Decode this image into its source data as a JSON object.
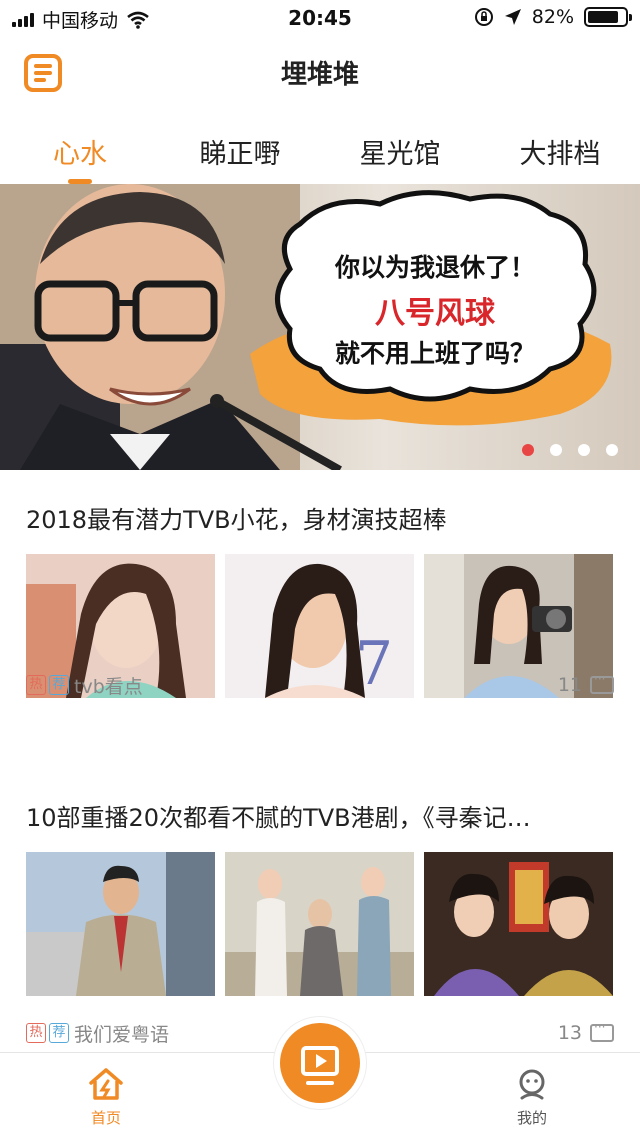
{
  "status_bar": {
    "carrier": "中国移动",
    "time": "20:45",
    "battery": "82%",
    "battery_level": 0.82
  },
  "header": {
    "title": "埋堆堆"
  },
  "tabs": [
    {
      "label": "心水",
      "active": true
    },
    {
      "label": "睇正嘢",
      "active": false
    },
    {
      "label": "星光馆",
      "active": false
    },
    {
      "label": "大排档",
      "active": false
    }
  ],
  "banner": {
    "line1": "你以为我退休了！",
    "line2": "八号风球",
    "line3": "就不用上班了吗？",
    "slide_count": 4,
    "active_slide": 1
  },
  "articles": [
    {
      "headline": "2018最有潜力TVB小花，身材演技超棒",
      "tag_hot": "热",
      "tag_rec": "荐",
      "source": "tvb看点",
      "comments": "11"
    },
    {
      "headline": "10部重播20次都看不腻的TVB港剧，《寻秦记…",
      "tag_hot": "热",
      "tag_rec": "荐",
      "source": "我们爱粤语",
      "comments": "13"
    }
  ],
  "tabbar": {
    "home_label": "首页",
    "me_label": "我的"
  },
  "colors": {
    "accent": "#f08a24",
    "hot_tag": "#e36b5b",
    "rec_tag": "#57a9d9"
  }
}
